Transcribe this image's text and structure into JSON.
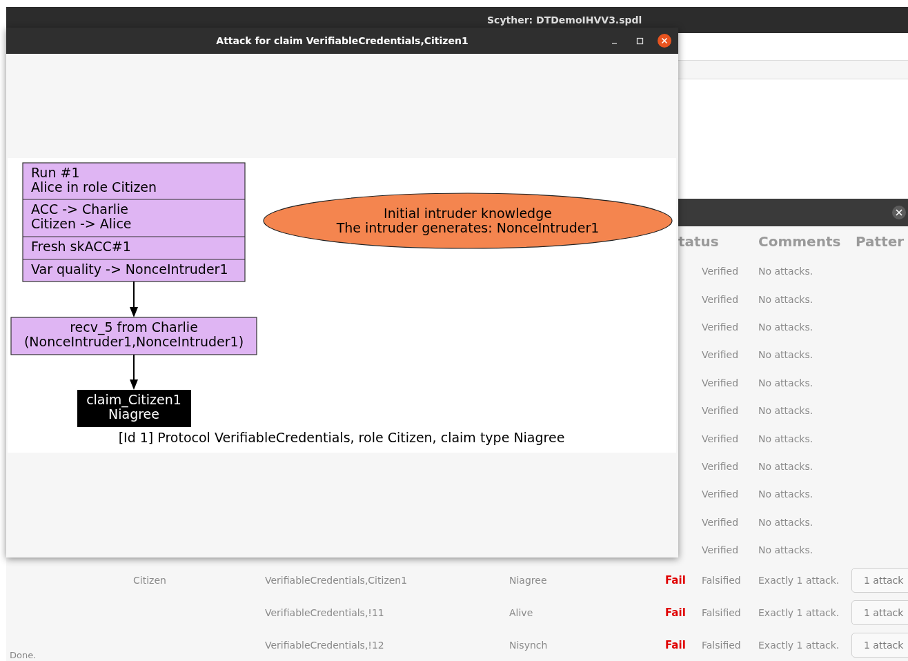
{
  "main_window": {
    "title": "Scyther: DTDemoIHVV3.spdl",
    "status_bar": "Done."
  },
  "results_window": {
    "columns": [
      "tatus",
      "Comments",
      "Patter"
    ],
    "rows": [
      {
        "result": "Verified",
        "comments": "No attacks."
      },
      {
        "result": "Verified",
        "comments": "No attacks."
      },
      {
        "result": "Verified",
        "comments": "No attacks."
      },
      {
        "result": "Verified",
        "comments": "No attacks."
      },
      {
        "result": "Verified",
        "comments": "No attacks."
      },
      {
        "result": "Verified",
        "comments": "No attacks."
      },
      {
        "result": "Verified",
        "comments": "No attacks."
      },
      {
        "result": "Verified",
        "comments": "No attacks."
      },
      {
        "result": "Verified",
        "comments": "No attacks."
      },
      {
        "result": "Verified",
        "comments": "No attacks."
      },
      {
        "result": "Verified",
        "comments": "No attacks."
      },
      {
        "role": "Citizen",
        "claim": "VerifiableCredentials,Citizen1",
        "type": "Niagree",
        "status": "Fail",
        "result": "Falsified",
        "comments": "Exactly 1 attack.",
        "pattern": "1 attack"
      },
      {
        "claim": "VerifiableCredentials,!11",
        "type": "Alive",
        "status": "Fail",
        "result": "Falsified",
        "comments": "Exactly 1 attack.",
        "pattern": "1 attack"
      },
      {
        "claim": "VerifiableCredentials,!12",
        "type": "Nisynch",
        "status": "Fail",
        "result": "Falsified",
        "comments": "Exactly 1 attack.",
        "pattern": "1 attack"
      }
    ]
  },
  "attack_window": {
    "title": "Attack for claim VerifiableCredentials,Citizen1",
    "diagram": {
      "run_node": [
        [
          "Run #1",
          "Alice in role Citizen"
        ],
        [
          "ACC -> Charlie",
          "Citizen -> Alice"
        ],
        [
          "Fresh skACC#1"
        ],
        [
          "Var quality -> NonceIntruder1"
        ]
      ],
      "recv_node": [
        "recv_5 from Charlie",
        "(NonceIntruder1,NonceIntruder1)"
      ],
      "claim_node": [
        "claim_Citizen1",
        "Niagree"
      ],
      "intruder_node": [
        "Initial intruder knowledge",
        "The intruder generates: NonceIntruder1"
      ],
      "caption": "[Id 1] Protocol VerifiableCredentials, role Citizen, claim type Niagree"
    }
  }
}
